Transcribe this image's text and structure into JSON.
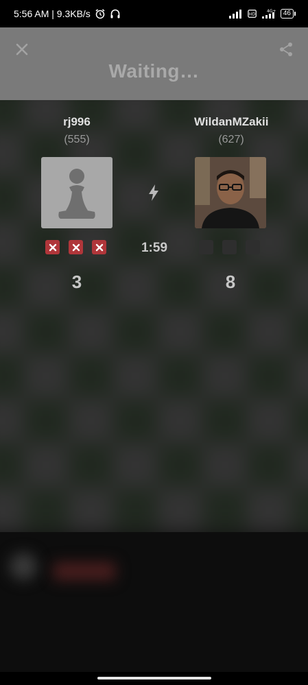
{
  "status_bar": {
    "time_speed": "5:56 AM | 9.3KB/s",
    "battery": "46",
    "network": "4G+"
  },
  "header": {
    "title": "Waiting…"
  },
  "game": {
    "timer": "1:59",
    "player_left": {
      "name": "rj996",
      "rating": "(555)",
      "score": "3"
    },
    "player_right": {
      "name": "WildanMZakii",
      "rating": "(627)",
      "score": "8"
    }
  },
  "icons": {
    "close": "close-icon",
    "share": "share-icon",
    "bolt": "lightning-bolt-icon",
    "pawn": "chess-pawn-icon"
  },
  "colors": {
    "loss_marker": "#b0363a",
    "pending_marker": "#2e2e2e",
    "header_bg": "#7a7a7a"
  }
}
